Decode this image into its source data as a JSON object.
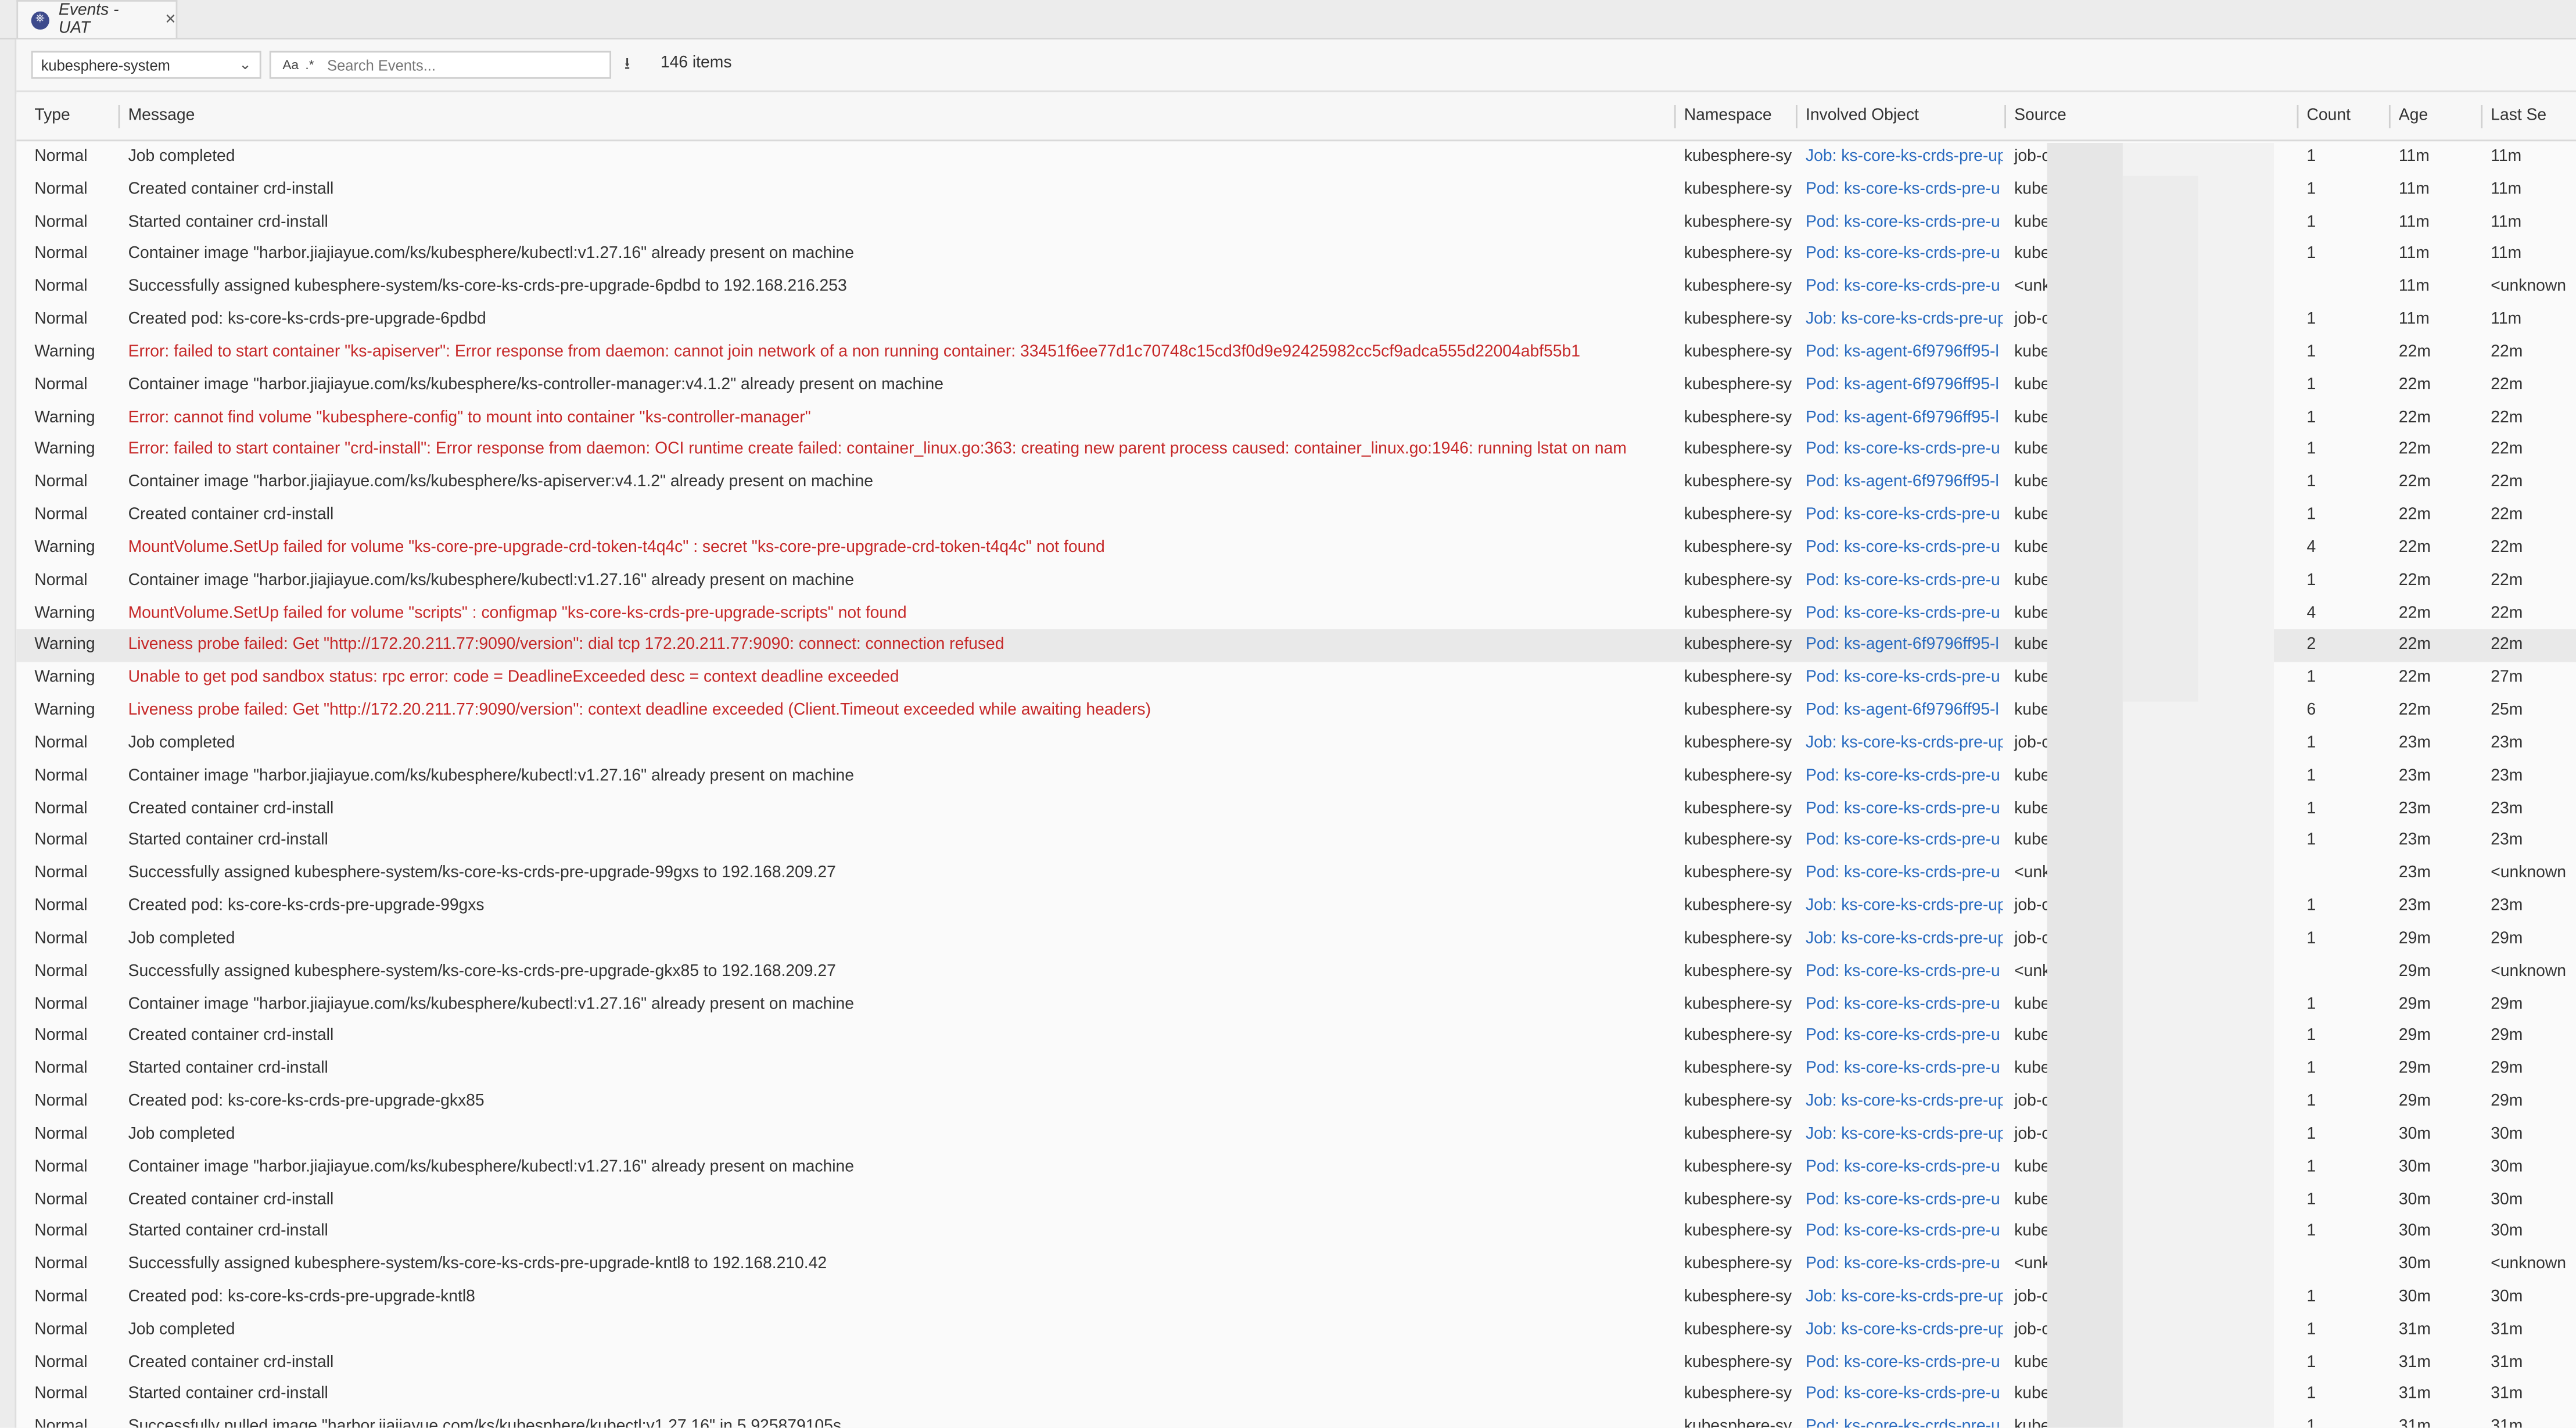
{
  "tab": {
    "title": "Events - UAT",
    "close": "×"
  },
  "toolbar": {
    "namespace": "kubesphere-system",
    "case_icon": "Aa",
    "regex_icon": ".*",
    "search_placeholder": "Search Events...",
    "download_icon": "⭳",
    "item_count": "146 items"
  },
  "columns": {
    "type": "Type",
    "message": "Message",
    "namespace": "Namespace",
    "involved_object": "Involved Object",
    "source": "Source",
    "count": "Count",
    "age": "Age",
    "last_seen": "Last Se"
  },
  "colors": {
    "warning_text": "#c62828",
    "link": "#2a6bc0"
  },
  "rows": [
    [
      "Normal",
      "Job completed",
      "kubesphere-sy",
      "Job: ks-core-ks-crds-pre-up",
      "job-co",
      "1",
      "11m",
      "11m"
    ],
    [
      "Normal",
      "Created container crd-install",
      "kubesphere-sy",
      "Pod: ks-core-ks-crds-pre-u",
      "kubele",
      "1",
      "11m",
      "11m"
    ],
    [
      "Normal",
      "Started container crd-install",
      "kubesphere-sy",
      "Pod: ks-core-ks-crds-pre-u",
      "kubele",
      "1",
      "11m",
      "11m"
    ],
    [
      "Normal",
      "Container image \"harbor.jiajiayue.com/ks/kubesphere/kubectl:v1.27.16\" already present on machine",
      "kubesphere-sy",
      "Pod: ks-core-ks-crds-pre-u",
      "kubele",
      "1",
      "11m",
      "11m"
    ],
    [
      "Normal",
      "Successfully assigned kubesphere-system/ks-core-ks-crds-pre-upgrade-6pdbd to 192.168.216.253",
      "kubesphere-sy",
      "Pod: ks-core-ks-crds-pre-u",
      "<unkn",
      "",
      "11m",
      "<unknown"
    ],
    [
      "Normal",
      "Created pod: ks-core-ks-crds-pre-upgrade-6pdbd",
      "kubesphere-sy",
      "Job: ks-core-ks-crds-pre-up",
      "job-co",
      "1",
      "11m",
      "11m"
    ],
    [
      "Warning",
      "Error: failed to start container \"ks-apiserver\": Error response from daemon: cannot join network of a non running container: 33451f6ee77d1c70748c15cd3f0d9e92425982cc5cf9adca555d22004abf55b1",
      "kubesphere-sy",
      "Pod: ks-agent-6f9796ff95-l",
      "kubele",
      "1",
      "22m",
      "22m"
    ],
    [
      "Normal",
      "Container image \"harbor.jiajiayue.com/ks/kubesphere/ks-controller-manager:v4.1.2\" already present on machine",
      "kubesphere-sy",
      "Pod: ks-agent-6f9796ff95-l",
      "kubele",
      "1",
      "22m",
      "22m"
    ],
    [
      "Warning",
      "Error: cannot find volume \"kubesphere-config\" to mount into container \"ks-controller-manager\"",
      "kubesphere-sy",
      "Pod: ks-agent-6f9796ff95-l",
      "kubele",
      "1",
      "22m",
      "22m"
    ],
    [
      "Warning",
      "Error: failed to start container \"crd-install\": Error response from daemon: OCI runtime create failed: container_linux.go:363: creating new parent process caused: container_linux.go:1946: running lstat on nam",
      "kubesphere-sy",
      "Pod: ks-core-ks-crds-pre-u",
      "kubele",
      "1",
      "22m",
      "22m"
    ],
    [
      "Normal",
      "Container image \"harbor.jiajiayue.com/ks/kubesphere/ks-apiserver:v4.1.2\" already present on machine",
      "kubesphere-sy",
      "Pod: ks-agent-6f9796ff95-l",
      "kubele",
      "1",
      "22m",
      "22m"
    ],
    [
      "Normal",
      "Created container crd-install",
      "kubesphere-sy",
      "Pod: ks-core-ks-crds-pre-u",
      "kubele",
      "1",
      "22m",
      "22m"
    ],
    [
      "Warning",
      "MountVolume.SetUp failed for volume \"ks-core-pre-upgrade-crd-token-t4q4c\" : secret \"ks-core-pre-upgrade-crd-token-t4q4c\" not found",
      "kubesphere-sy",
      "Pod: ks-core-ks-crds-pre-u",
      "kubele",
      "4",
      "22m",
      "22m"
    ],
    [
      "Normal",
      "Container image \"harbor.jiajiayue.com/ks/kubesphere/kubectl:v1.27.16\" already present on machine",
      "kubesphere-sy",
      "Pod: ks-core-ks-crds-pre-u",
      "kubele",
      "1",
      "22m",
      "22m"
    ],
    [
      "Warning",
      "MountVolume.SetUp failed for volume \"scripts\" : configmap \"ks-core-ks-crds-pre-upgrade-scripts\" not found",
      "kubesphere-sy",
      "Pod: ks-core-ks-crds-pre-u",
      "kubele",
      "4",
      "22m",
      "22m"
    ],
    [
      "Warning",
      "Liveness probe failed: Get \"http://172.20.211.77:9090/version\": dial tcp 172.20.211.77:9090: connect: connection refused",
      "kubesphere-sy",
      "Pod: ks-agent-6f9796ff95-l",
      "kubele",
      "2",
      "22m",
      "22m"
    ],
    [
      "Warning",
      "Unable to get pod sandbox status: rpc error: code = DeadlineExceeded desc = context deadline exceeded",
      "kubesphere-sy",
      "Pod: ks-core-ks-crds-pre-u",
      "kubele",
      "1",
      "22m",
      "27m"
    ],
    [
      "Warning",
      "Liveness probe failed: Get \"http://172.20.211.77:9090/version\": context deadline exceeded (Client.Timeout exceeded while awaiting headers)",
      "kubesphere-sy",
      "Pod: ks-agent-6f9796ff95-l",
      "kubele",
      "6",
      "22m",
      "25m"
    ],
    [
      "Normal",
      "Job completed",
      "kubesphere-sy",
      "Job: ks-core-ks-crds-pre-up",
      "job-co",
      "1",
      "23m",
      "23m"
    ],
    [
      "Normal",
      "Container image \"harbor.jiajiayue.com/ks/kubesphere/kubectl:v1.27.16\" already present on machine",
      "kubesphere-sy",
      "Pod: ks-core-ks-crds-pre-u",
      "kubele",
      "1",
      "23m",
      "23m"
    ],
    [
      "Normal",
      "Created container crd-install",
      "kubesphere-sy",
      "Pod: ks-core-ks-crds-pre-u",
      "kubele",
      "1",
      "23m",
      "23m"
    ],
    [
      "Normal",
      "Started container crd-install",
      "kubesphere-sy",
      "Pod: ks-core-ks-crds-pre-u",
      "kubele",
      "1",
      "23m",
      "23m"
    ],
    [
      "Normal",
      "Successfully assigned kubesphere-system/ks-core-ks-crds-pre-upgrade-99gxs to 192.168.209.27",
      "kubesphere-sy",
      "Pod: ks-core-ks-crds-pre-u",
      "<unkn",
      "",
      "23m",
      "<unknown"
    ],
    [
      "Normal",
      "Created pod: ks-core-ks-crds-pre-upgrade-99gxs",
      "kubesphere-sy",
      "Job: ks-core-ks-crds-pre-up",
      "job-co",
      "1",
      "23m",
      "23m"
    ],
    [
      "Normal",
      "Job completed",
      "kubesphere-sy",
      "Job: ks-core-ks-crds-pre-up",
      "job-co",
      "1",
      "29m",
      "29m"
    ],
    [
      "Normal",
      "Successfully assigned kubesphere-system/ks-core-ks-crds-pre-upgrade-gkx85 to 192.168.209.27",
      "kubesphere-sy",
      "Pod: ks-core-ks-crds-pre-u",
      "<unkn",
      "",
      "29m",
      "<unknown"
    ],
    [
      "Normal",
      "Container image \"harbor.jiajiayue.com/ks/kubesphere/kubectl:v1.27.16\" already present on machine",
      "kubesphere-sy",
      "Pod: ks-core-ks-crds-pre-u",
      "kubele",
      "1",
      "29m",
      "29m"
    ],
    [
      "Normal",
      "Created container crd-install",
      "kubesphere-sy",
      "Pod: ks-core-ks-crds-pre-u",
      "kubele",
      "1",
      "29m",
      "29m"
    ],
    [
      "Normal",
      "Started container crd-install",
      "kubesphere-sy",
      "Pod: ks-core-ks-crds-pre-u",
      "kubele",
      "1",
      "29m",
      "29m"
    ],
    [
      "Normal",
      "Created pod: ks-core-ks-crds-pre-upgrade-gkx85",
      "kubesphere-sy",
      "Job: ks-core-ks-crds-pre-up",
      "job-co",
      "1",
      "29m",
      "29m"
    ],
    [
      "Normal",
      "Job completed",
      "kubesphere-sy",
      "Job: ks-core-ks-crds-pre-up",
      "job-co",
      "1",
      "30m",
      "30m"
    ],
    [
      "Normal",
      "Container image \"harbor.jiajiayue.com/ks/kubesphere/kubectl:v1.27.16\" already present on machine",
      "kubesphere-sy",
      "Pod: ks-core-ks-crds-pre-u",
      "kubele",
      "1",
      "30m",
      "30m"
    ],
    [
      "Normal",
      "Created container crd-install",
      "kubesphere-sy",
      "Pod: ks-core-ks-crds-pre-u",
      "kubele",
      "1",
      "30m",
      "30m"
    ],
    [
      "Normal",
      "Started container crd-install",
      "kubesphere-sy",
      "Pod: ks-core-ks-crds-pre-u",
      "kubele",
      "1",
      "30m",
      "30m"
    ],
    [
      "Normal",
      "Successfully assigned kubesphere-system/ks-core-ks-crds-pre-upgrade-kntl8 to 192.168.210.42",
      "kubesphere-sy",
      "Pod: ks-core-ks-crds-pre-u",
      "<unkn",
      "",
      "30m",
      "<unknown"
    ],
    [
      "Normal",
      "Created pod: ks-core-ks-crds-pre-upgrade-kntl8",
      "kubesphere-sy",
      "Job: ks-core-ks-crds-pre-up",
      "job-co",
      "1",
      "30m",
      "30m"
    ],
    [
      "Normal",
      "Job completed",
      "kubesphere-sy",
      "Job: ks-core-ks-crds-pre-up",
      "job-co",
      "1",
      "31m",
      "31m"
    ],
    [
      "Normal",
      "Created container crd-install",
      "kubesphere-sy",
      "Pod: ks-core-ks-crds-pre-u",
      "kubele",
      "1",
      "31m",
      "31m"
    ],
    [
      "Normal",
      "Started container crd-install",
      "kubesphere-sy",
      "Pod: ks-core-ks-crds-pre-u",
      "kubele",
      "1",
      "31m",
      "31m"
    ],
    [
      "Normal",
      "Successfully pulled image \"harbor.jiajiayue.com/ks/kubesphere/kubectl:v1.27.16\" in 5.925879105s",
      "kubesphere-sy",
      "Pod: ks-core-ks-crds-pre-u",
      "kubele",
      "1",
      "31m",
      "31m"
    ]
  ],
  "highlighted_row": 15
}
